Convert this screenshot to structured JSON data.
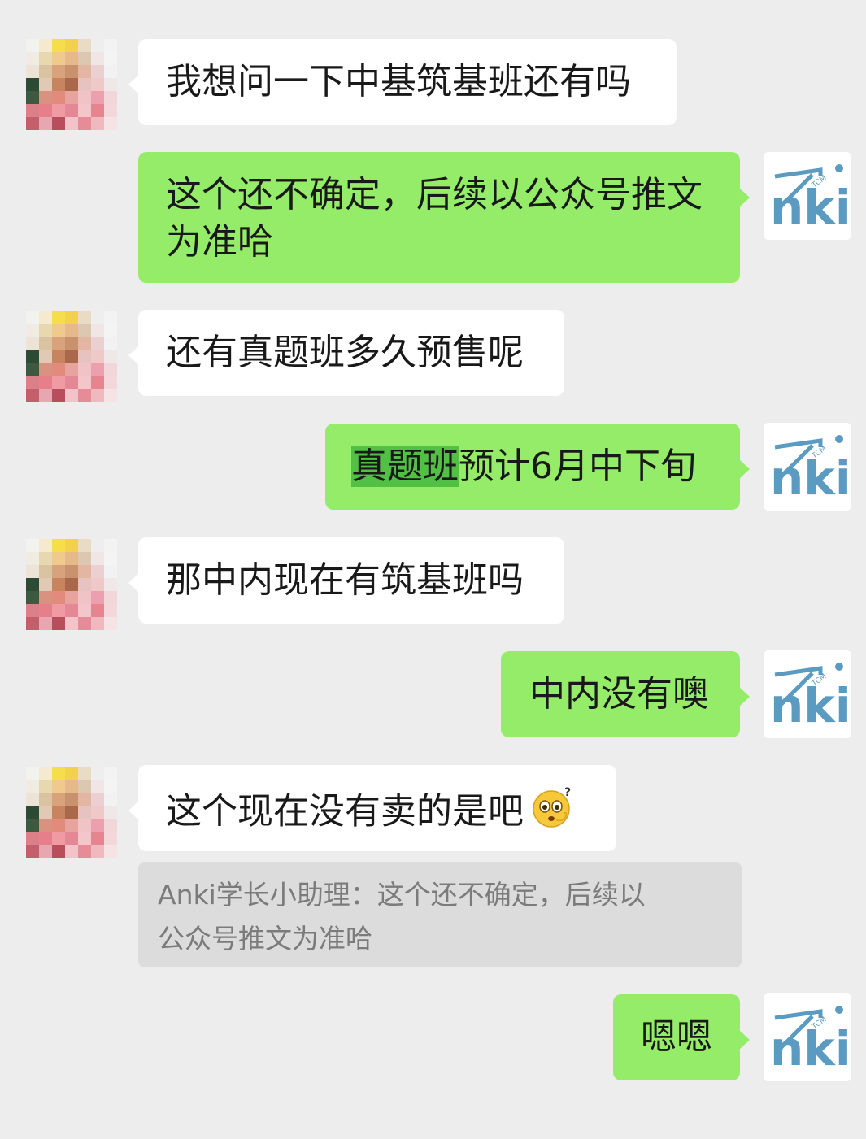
{
  "messages": [
    {
      "side": "left",
      "text": "我想问一下中基筑基班还有吗"
    },
    {
      "side": "right",
      "text_line1": "这个还不确定，后续以公众号推文",
      "text_line2": "为准哈"
    },
    {
      "side": "left",
      "text": "还有真题班多久预售呢"
    },
    {
      "side": "right",
      "highlight": "真题班",
      "text_rest": "预计6月中下旬"
    },
    {
      "side": "left",
      "text": "那中内现在有筑基班吗"
    },
    {
      "side": "right",
      "text": "中内没有噢"
    },
    {
      "side": "left",
      "text": "这个现在没有卖的是吧",
      "emoji": "thinking-face-emoji"
    },
    {
      "side": "right",
      "text": "嗯嗯"
    }
  ],
  "quote": {
    "line1": "Anki学长小助理：这个还不确定，后续以",
    "line2": "公众号推文为准哈"
  },
  "avatar_right": {
    "logo_text": "nki",
    "tag": "TCM",
    "color": "#5b9bc2"
  },
  "colors": {
    "background": "#ededed",
    "bubble_in": "#ffffff",
    "bubble_out": "#95ec69"
  }
}
